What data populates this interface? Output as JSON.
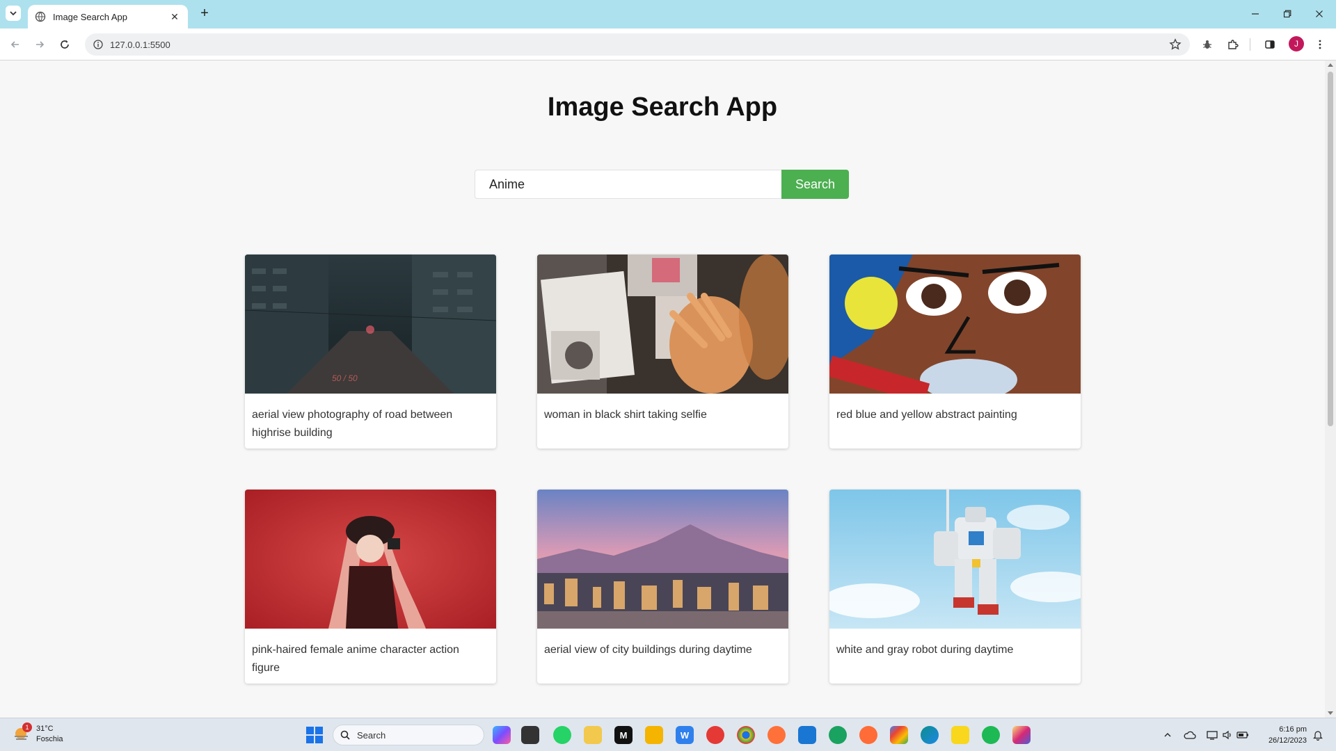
{
  "browser": {
    "tab_title": "Image Search App",
    "url": "127.0.0.1:5500",
    "profile_initial": "J"
  },
  "app": {
    "title": "Image Search App",
    "search": {
      "value": "Anime",
      "button_label": "Search"
    },
    "results": [
      {
        "description": "aerial view photography of road between highrise building"
      },
      {
        "description": "woman in black shirt taking selfie"
      },
      {
        "description": "red blue and yellow abstract painting"
      },
      {
        "description": "pink-haired female anime character action figure"
      },
      {
        "description": "aerial view of city buildings during daytime"
      },
      {
        "description": "white and gray robot during daytime"
      }
    ]
  },
  "taskbar": {
    "weather": {
      "temp": "31°C",
      "condition": "Foschia",
      "badge": "1"
    },
    "search_label": "Search",
    "clock": {
      "time": "6:16 pm",
      "date": "26/12/2023"
    },
    "accent": "#4caf50"
  }
}
